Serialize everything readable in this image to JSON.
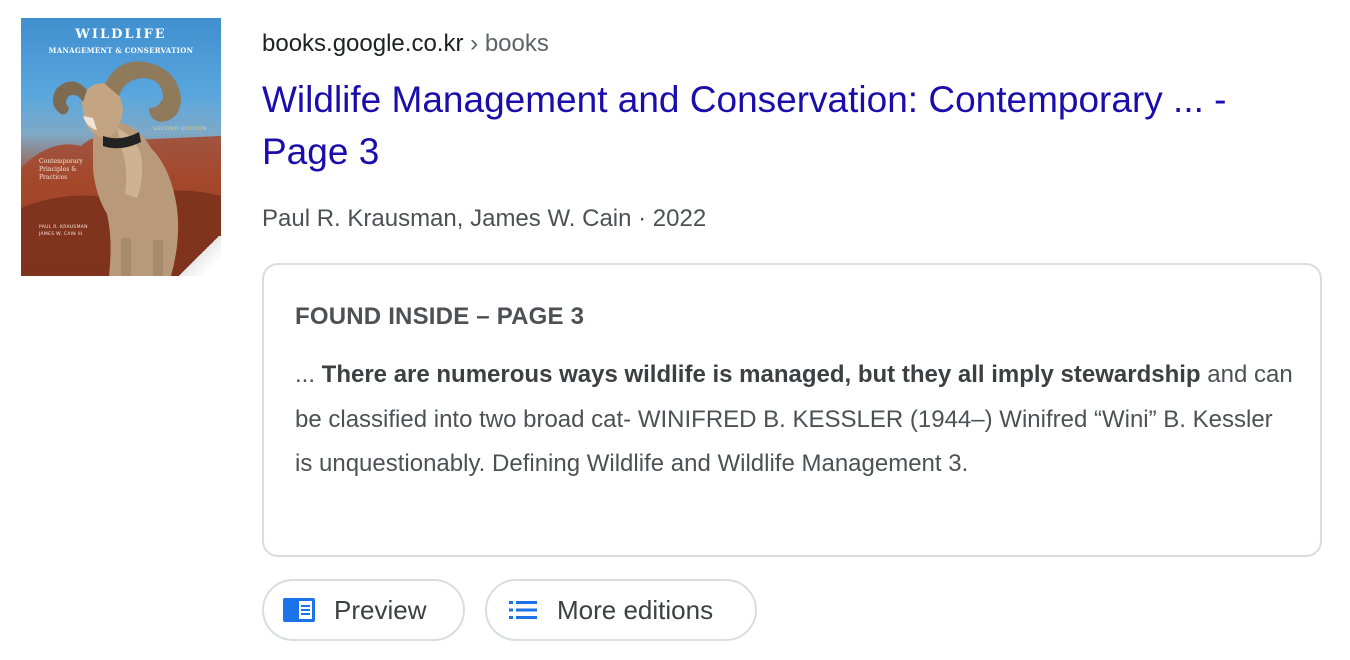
{
  "cover": {
    "title": "WILDLIFE",
    "subtitle": "MANAGEMENT & CONSERVATION",
    "edition": "SECOND EDITION",
    "tagline": "Contemporary Principles & Practices",
    "authors_line1": "PAUL R. KRAUSMAN",
    "authors_line2": "JAMES W. CAIN III"
  },
  "result": {
    "site": "books.google.co.kr",
    "separator": "›",
    "path": "books",
    "title": "Wildlife Management and Conservation: Contemporary ... - Page 3",
    "byline": "Paul R. Krausman, James W. Cain · 2022"
  },
  "snippet": {
    "label": "FOUND INSIDE – PAGE 3",
    "prefix": "... ",
    "bold": "There are numerous ways wildlife is managed, but they all imply stewardship",
    "rest": " and can be classified into two broad cat- WINIFRED B. KESSLER (1944–) Winifred “Wini” B. Kessler is unquestionably. Defining Wildlife and Wildlife Management 3."
  },
  "actions": {
    "preview_label": "Preview",
    "preview_icon": "book-preview-icon",
    "editions_label": "More editions",
    "editions_icon": "list-icon"
  },
  "colors": {
    "link": "#1a0dab",
    "text": "#4d5156",
    "border": "#dadce0",
    "icon_blue": "#1a73e8"
  }
}
